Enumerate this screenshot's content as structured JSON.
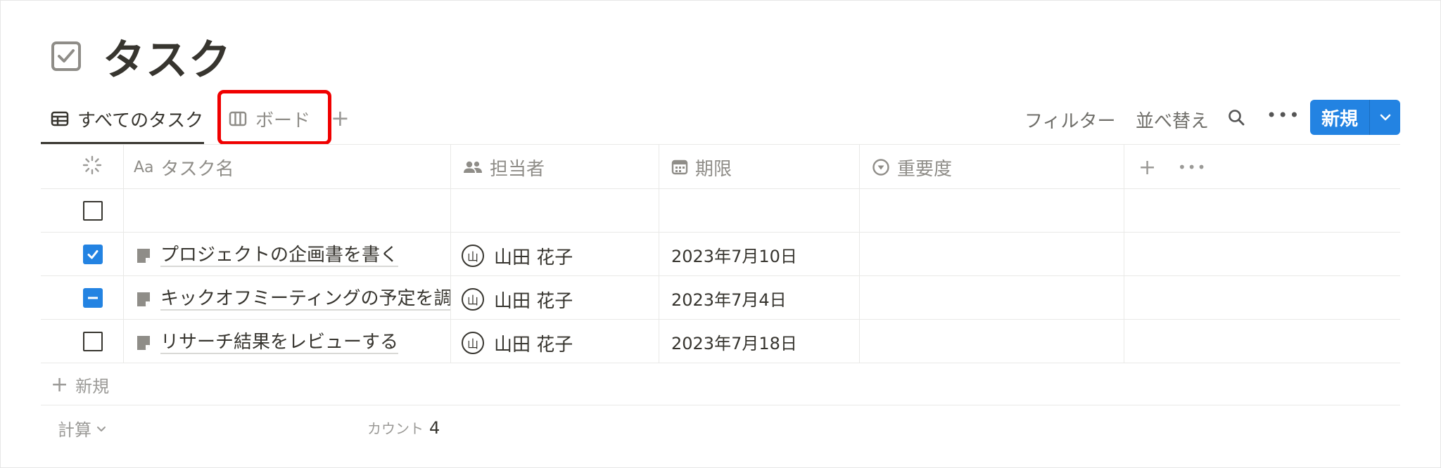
{
  "page": {
    "title": "タスク",
    "title_icon": "checkbox-icon"
  },
  "views": {
    "tabs": [
      {
        "label": "すべてのタスク",
        "icon": "table-icon",
        "active": true
      },
      {
        "label": "ボード",
        "icon": "board-icon",
        "active": false,
        "highlighted": true
      }
    ],
    "add_view": "+"
  },
  "toolbar": {
    "filter_label": "フィルター",
    "sort_label": "並べ替え",
    "search_icon": "search-icon",
    "more_label": "•••",
    "new_label": "新規",
    "new_chevron_icon": "chevron-down-icon",
    "accent_color": "#2383e2"
  },
  "table": {
    "columns": [
      {
        "label": "",
        "icon": "loading-icon"
      },
      {
        "label": "タスク名",
        "icon_text": "Aa"
      },
      {
        "label": "担当者",
        "icon": "people-icon"
      },
      {
        "label": "期限",
        "icon": "calendar-icon"
      },
      {
        "label": "重要度",
        "icon": "select-icon"
      }
    ],
    "add_column": "+",
    "column_more": "•••",
    "rows": [
      {
        "status": "unchecked",
        "name": "",
        "assignee": "",
        "avatar": "",
        "due": ""
      },
      {
        "status": "checked",
        "name": "プロジェクトの企画書を書く",
        "assignee": "山田 花子",
        "avatar": "山",
        "due": "2023年7月10日"
      },
      {
        "status": "partial",
        "name": "キックオフミーティングの予定を調",
        "assignee": "山田 花子",
        "avatar": "山",
        "due": "2023年7月4日"
      },
      {
        "status": "unchecked",
        "name": "リサーチ結果をレビューする",
        "assignee": "山田 花子",
        "avatar": "山",
        "due": "2023年7月18日"
      }
    ],
    "add_row_label": "新規",
    "calc_label": "計算",
    "count_label": "カウント",
    "count_value": "4"
  }
}
